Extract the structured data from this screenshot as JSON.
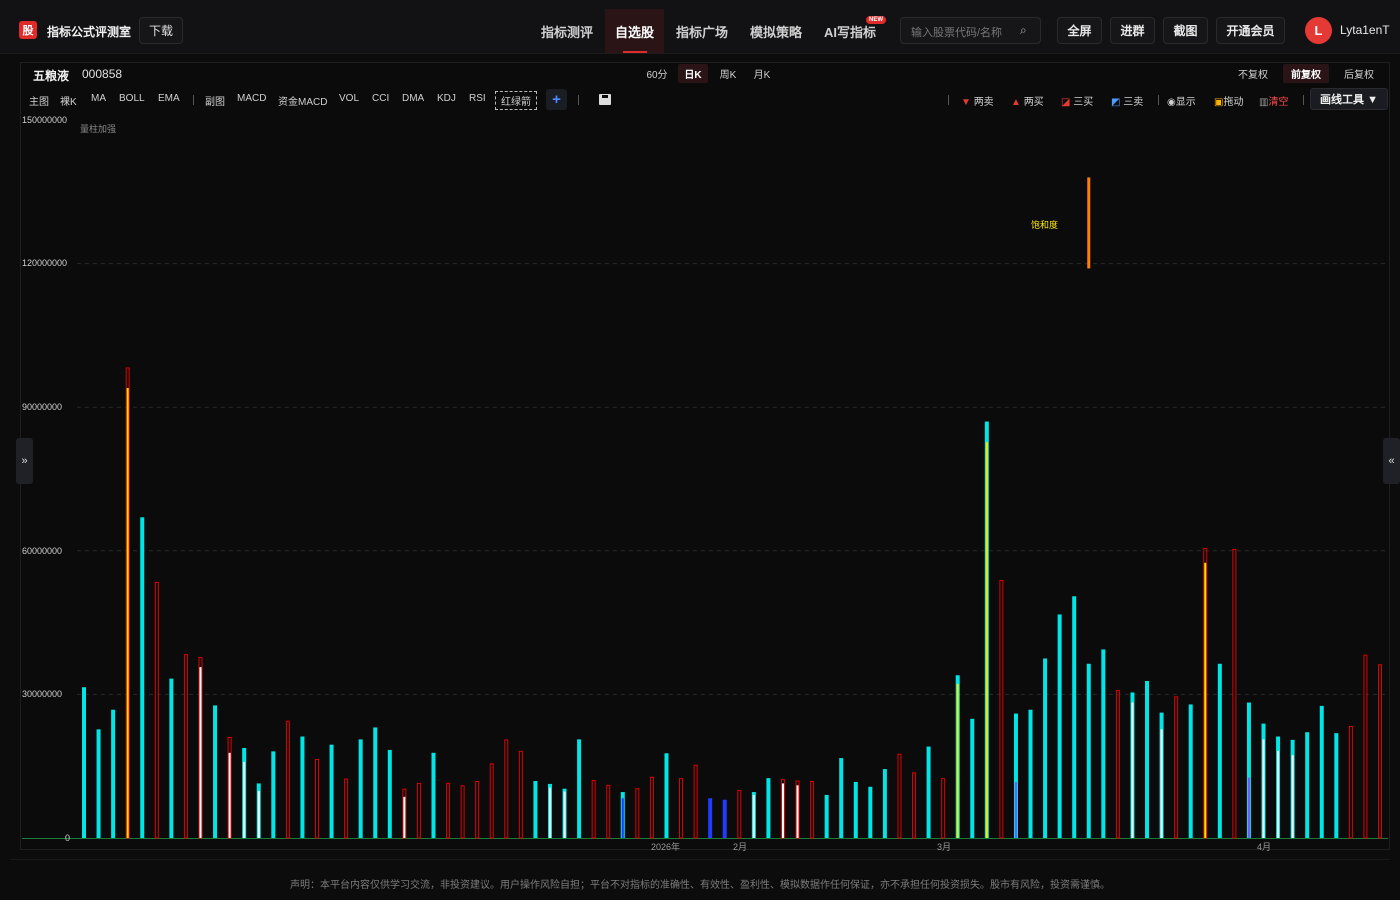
{
  "header": {
    "logo_char": "股",
    "app_title": "指标公式评测室",
    "download_label": "下载",
    "nav": [
      "指标测评",
      "自选股",
      "指标广场",
      "模拟策略",
      "AI写指标"
    ],
    "new_badge": "NEW",
    "search_placeholder": "输入股票代码/名称",
    "buttons": [
      "全屏",
      "进群",
      "截图",
      "开通会员"
    ],
    "avatar_letter": "L",
    "username": "Lyta1enT"
  },
  "stock": {
    "name": "五粮液",
    "code": "000858"
  },
  "periods": [
    "60分",
    "日K",
    "周K",
    "月K"
  ],
  "adjust": [
    "不复权",
    "前复权",
    "后复权"
  ],
  "toolbar": {
    "items": [
      "主图",
      "裸K",
      "MA",
      "BOLL",
      "EMA",
      "副图",
      "MACD",
      "资金MACD",
      "VOL",
      "CCI",
      "DMA",
      "KDJ",
      "RSI"
    ],
    "boxed_item": "红绿箭",
    "plus": "+",
    "marks": [
      "两卖",
      "两买",
      "三买",
      "三卖",
      "显示",
      "拖动",
      "清空"
    ],
    "draw_tool": "画线工具 ▼"
  },
  "side": {
    "left": "»",
    "right": "«"
  },
  "chart_data": {
    "type": "bar",
    "title": "量柱加强",
    "annotation": "饱和度",
    "ylim": [
      0,
      150000000
    ],
    "yticks": [
      "150000000",
      "120000000",
      "90000000",
      "60000000",
      "30000000",
      "0"
    ],
    "xlabels": [
      "2026年",
      "2月",
      "3月",
      "4月"
    ],
    "colors": {
      "up": "#e00000",
      "down": "#00e5e5",
      "yellow": "#ffe600",
      "white": "#ffffff",
      "blue": "#1f3cff",
      "purple": "#7a55ff",
      "orange": "#ff8000"
    },
    "series": [
      {
        "v": 31500000,
        "c": "down"
      },
      {
        "v": 22700000,
        "c": "down"
      },
      {
        "v": 26800000,
        "c": "down"
      },
      {
        "v": 98200000,
        "c": "up",
        "inner": 94000000,
        "ic": "yellow"
      },
      {
        "v": 67000000,
        "c": "down"
      },
      {
        "v": 53400000,
        "c": "up"
      },
      {
        "v": 33300000,
        "c": "down"
      },
      {
        "v": 38300000,
        "c": "up"
      },
      {
        "v": 37700000,
        "c": "up",
        "inner": 35700000,
        "ic": "white"
      },
      {
        "v": 27700000,
        "c": "down"
      },
      {
        "v": 21000000,
        "c": "up",
        "inner": 17800000,
        "ic": "white"
      },
      {
        "v": 18800000,
        "c": "down",
        "inner": 15900000,
        "ic": "white"
      },
      {
        "v": 11400000,
        "c": "down",
        "inner": 9800000,
        "ic": "white"
      },
      {
        "v": 18100000,
        "c": "down"
      },
      {
        "v": 24400000,
        "c": "up"
      },
      {
        "v": 21200000,
        "c": "down"
      },
      {
        "v": 16400000,
        "c": "up"
      },
      {
        "v": 19500000,
        "c": "down"
      },
      {
        "v": 12300000,
        "c": "up"
      },
      {
        "v": 20600000,
        "c": "down"
      },
      {
        "v": 23100000,
        "c": "down"
      },
      {
        "v": 18400000,
        "c": "down"
      },
      {
        "v": 10200000,
        "c": "up",
        "inner": 8600000,
        "ic": "white"
      },
      {
        "v": 11400000,
        "c": "up"
      },
      {
        "v": 17800000,
        "c": "down"
      },
      {
        "v": 11400000,
        "c": "up"
      },
      {
        "v": 10900000,
        "c": "up"
      },
      {
        "v": 11800000,
        "c": "up"
      },
      {
        "v": 15500000,
        "c": "up"
      },
      {
        "v": 20500000,
        "c": "up"
      },
      {
        "v": 18100000,
        "c": "up"
      },
      {
        "v": 11900000,
        "c": "down"
      },
      {
        "v": 11300000,
        "c": "down",
        "inner": 10500000,
        "ic": "white"
      },
      {
        "v": 10300000,
        "c": "down",
        "inner": 9700000,
        "ic": "white"
      },
      {
        "v": 20600000,
        "c": "down"
      },
      {
        "v": 12000000,
        "c": "up"
      },
      {
        "v": 11000000,
        "c": "up"
      },
      {
        "v": 9600000,
        "c": "down",
        "inner": 8300000,
        "ic": "blue"
      },
      {
        "v": 10300000,
        "c": "up"
      },
      {
        "v": 12700000,
        "c": "up"
      },
      {
        "v": 17700000,
        "c": "down"
      },
      {
        "v": 12400000,
        "c": "up"
      },
      {
        "v": 15200000,
        "c": "up"
      },
      {
        "v": 8300000,
        "c": "blue"
      },
      {
        "v": 8000000,
        "c": "blue"
      },
      {
        "v": 9900000,
        "c": "up"
      },
      {
        "v": 9600000,
        "c": "down",
        "inner": 9000000,
        "ic": "white"
      },
      {
        "v": 12500000,
        "c": "down"
      },
      {
        "v": 12200000,
        "c": "up",
        "inner": 11400000,
        "ic": "white"
      },
      {
        "v": 11900000,
        "c": "up",
        "inner": 11000000,
        "ic": "white"
      },
      {
        "v": 11800000,
        "c": "up"
      },
      {
        "v": 9000000,
        "c": "down"
      },
      {
        "v": 16700000,
        "c": "down"
      },
      {
        "v": 11700000,
        "c": "down"
      },
      {
        "v": 10700000,
        "c": "down"
      },
      {
        "v": 14400000,
        "c": "down"
      },
      {
        "v": 17500000,
        "c": "up"
      },
      {
        "v": 13600000,
        "c": "up"
      },
      {
        "v": 19100000,
        "c": "down"
      },
      {
        "v": 12400000,
        "c": "up"
      },
      {
        "v": 34000000,
        "c": "down",
        "inner": 32200000,
        "ic": "yellow"
      },
      {
        "v": 24900000,
        "c": "down"
      },
      {
        "v": 87000000,
        "c": "down",
        "inner": 82700000,
        "ic": "yellow"
      },
      {
        "v": 53800000,
        "c": "up"
      },
      {
        "v": 26000000,
        "c": "down",
        "inner": 11700000,
        "ic": "purple"
      },
      {
        "v": 26800000,
        "c": "down"
      },
      {
        "v": 37500000,
        "c": "down"
      },
      {
        "v": 46700000,
        "c": "down"
      },
      {
        "v": 50500000,
        "c": "down"
      },
      {
        "v": 36400000,
        "c": "down"
      },
      {
        "v": 39400000,
        "c": "down"
      },
      {
        "v": 30800000,
        "c": "up"
      },
      {
        "v": 30400000,
        "c": "down",
        "inner": 28300000,
        "ic": "white"
      },
      {
        "v": 32800000,
        "c": "down"
      },
      {
        "v": 26200000,
        "c": "down",
        "inner": 22700000,
        "ic": "white"
      },
      {
        "v": 29500000,
        "c": "up"
      },
      {
        "v": 27900000,
        "c": "down"
      },
      {
        "v": 60500000,
        "c": "up",
        "inner": 57500000,
        "ic": "yellow"
      },
      {
        "v": 36400000,
        "c": "down"
      },
      {
        "v": 60300000,
        "c": "up"
      },
      {
        "v": 28300000,
        "c": "down",
        "inner": 12600000,
        "ic": "purple"
      },
      {
        "v": 23900000,
        "c": "down",
        "inner": 20600000,
        "ic": "white"
      },
      {
        "v": 21200000,
        "c": "down",
        "inner": 18200000,
        "ic": "white"
      },
      {
        "v": 20500000,
        "c": "down",
        "inner": 17300000,
        "ic": "white"
      },
      {
        "v": 22100000,
        "c": "down"
      },
      {
        "v": 27600000,
        "c": "down"
      },
      {
        "v": 21900000,
        "c": "down"
      },
      {
        "v": 23300000,
        "c": "up"
      },
      {
        "v": 38200000,
        "c": "up"
      },
      {
        "v": 36200000,
        "c": "up"
      }
    ],
    "spike": {
      "index": 69,
      "low": 119000000,
      "high": 138000000,
      "c": "orange"
    }
  },
  "disclaimer": "声明：本平台内容仅供学习交流，非投资建议。用户操作风险自担；平台不对指标的准确性、有效性、盈利性、模拟数据作任何保证，亦不承担任何投资损失。股市有风险，投资需谨慎。"
}
